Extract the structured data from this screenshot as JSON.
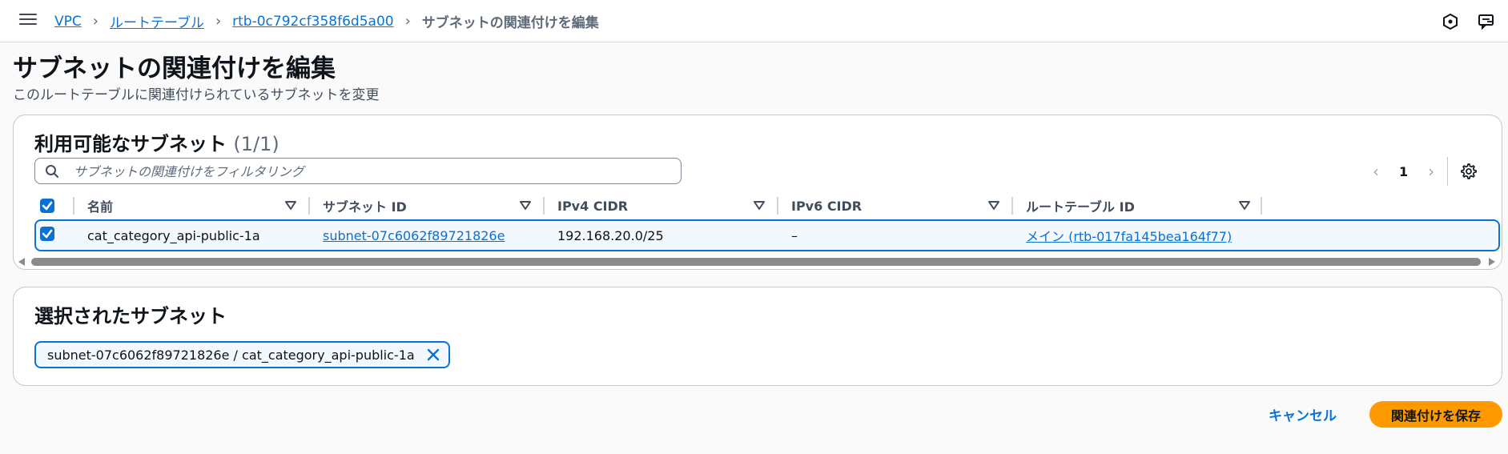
{
  "breadcrumb": {
    "items": [
      "VPC",
      "ルートテーブル",
      "rtb-0c792cf358f6d5a00"
    ],
    "current": "サブネットの関連付けを編集"
  },
  "header": {
    "title": "サブネットの関連付けを編集",
    "description": "このルートテーブルに関連付けられているサブネットを変更"
  },
  "available": {
    "title": "利用可能なサブネット",
    "count": "(1/1)",
    "search_placeholder": "サブネットの関連付けをフィルタリング",
    "page": "1",
    "columns": [
      "名前",
      "サブネット ID",
      "IPv4 CIDR",
      "IPv6 CIDR",
      "ルートテーブル ID"
    ],
    "rows": [
      {
        "checked": true,
        "name": "cat_category_api-public-1a",
        "subnet_id": "subnet-07c6062f89721826e",
        "ipv4": "192.168.20.0/25",
        "ipv6": "–",
        "route_table": "メイン (rtb-017fa145bea164f77)"
      }
    ]
  },
  "selected": {
    "title": "選択されたサブネット",
    "tokens": [
      "subnet-07c6062f89721826e / cat_category_api-public-1a"
    ]
  },
  "actions": {
    "cancel": "キャンセル",
    "save": "関連付けを保存"
  },
  "colors": {
    "accent": "#0972d3",
    "primary_button": "#ff9900"
  }
}
